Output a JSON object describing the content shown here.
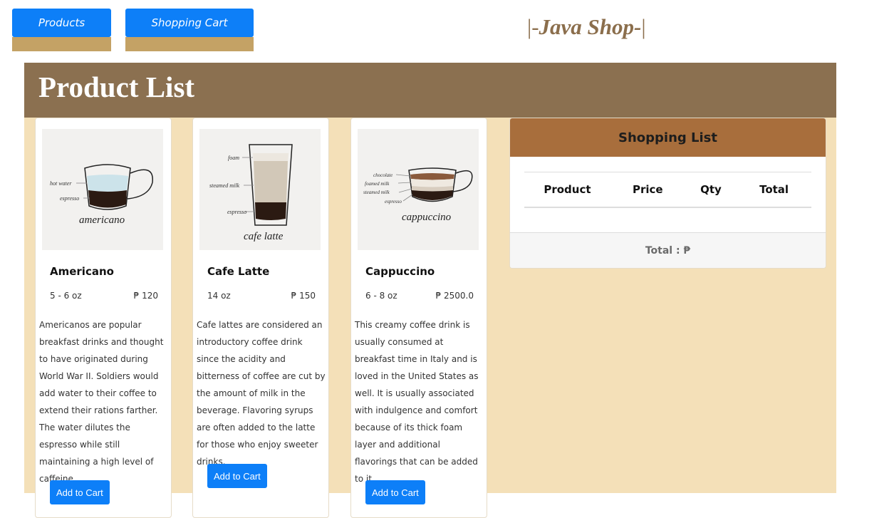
{
  "nav": {
    "products_label": "Products",
    "cart_label": "Shopping Cart"
  },
  "brand": {
    "prefix": "|-",
    "name": "Java Shop-",
    "suffix": "|"
  },
  "page_title": "Product List",
  "currency": "₱",
  "products": [
    {
      "name": "Americano",
      "size": "5 - 6 oz",
      "price": "₱ 120",
      "description": "Americanos are popular breakfast drinks and thought to have originated during World War II. Soldiers would add water to their coffee to extend their rations farther. The water dilutes the espresso while still maintaining a high level of caffeine.",
      "button": "Add to Cart",
      "illustration": {
        "labels": [
          "hot water",
          "espresso"
        ],
        "script": "americano"
      }
    },
    {
      "name": "Cafe Latte",
      "size": "14 oz",
      "price": "₱ 150",
      "description": "Cafe lattes are considered an introductory coffee drink since the acidity and bitterness of coffee are cut by the amount of milk in the beverage. Flavoring syrups are often added to the latte for those who enjoy sweeter drinks.",
      "button": "Add to Cart",
      "illustration": {
        "labels": [
          "foam",
          "steamed milk",
          "espresso"
        ],
        "script": "cafe latte"
      }
    },
    {
      "name": "Cappuccino",
      "size": "6 - 8 oz",
      "price": "₱ 2500.0",
      "description": "This creamy coffee drink is usually consumed at breakfast time in Italy and is loved in the United States as well. It is usually associated with indulgence and comfort because of its thick foam layer and additional flavorings that can be added to it.",
      "button": "Add to Cart",
      "illustration": {
        "labels": [
          "chocolate",
          "foamed milk",
          "steamed milk",
          "espresso"
        ],
        "script": "cappuccino"
      }
    }
  ],
  "shopping_list": {
    "title": "Shopping List",
    "columns": [
      "Product",
      "Price",
      "Qty",
      "Total"
    ],
    "rows": [],
    "total_label": "Total : ₱"
  },
  "colors": {
    "primary_button": "#0d7ff8",
    "header_bg": "#8b7050",
    "content_bg": "#f4e0b8",
    "list_header_bg": "#a86e3c",
    "brand_text": "#8b6e4c"
  }
}
